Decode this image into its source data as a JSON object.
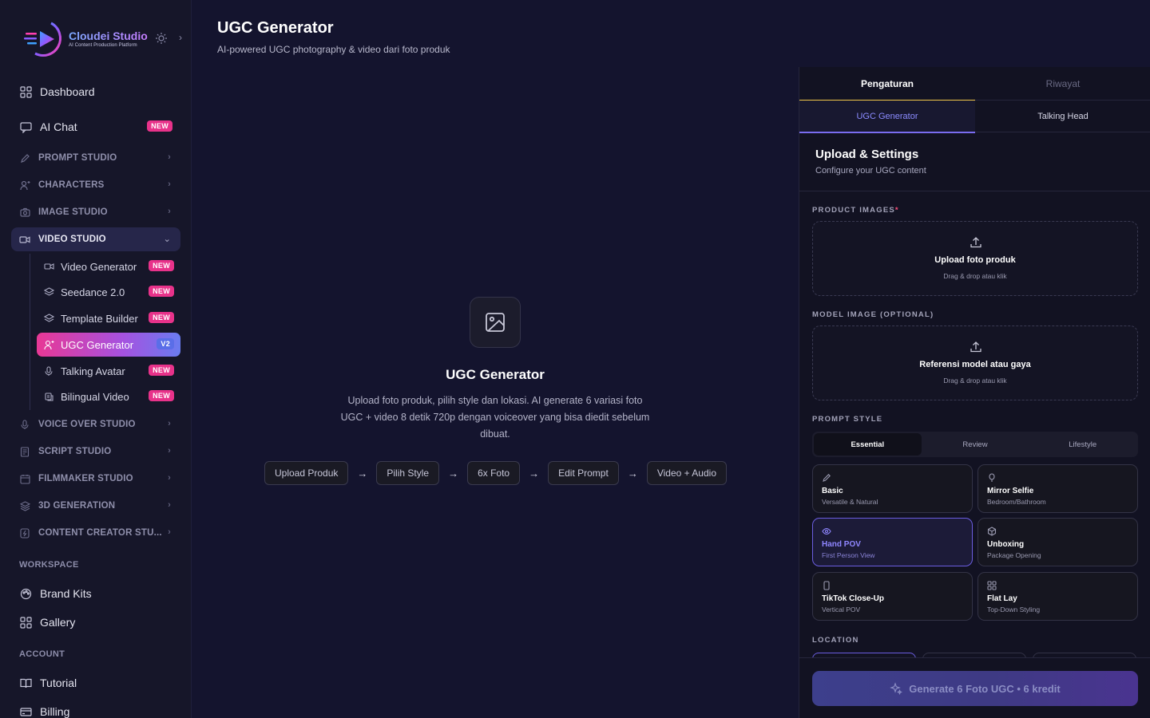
{
  "brand": {
    "name": "Cloudei Studio",
    "tagline": "AI Content Production Platform"
  },
  "sidebar": {
    "top_items": [
      {
        "label": "Dashboard",
        "icon": "grid-icon"
      },
      {
        "label": "AI Chat",
        "icon": "chat-icon",
        "badge": "NEW"
      }
    ],
    "sections": [
      {
        "label": "PROMPT STUDIO",
        "icon": "pen-icon"
      },
      {
        "label": "CHARACTERS",
        "icon": "user-sparkle-icon"
      },
      {
        "label": "IMAGE STUDIO",
        "icon": "camera-icon"
      },
      {
        "label": "VIDEO STUDIO",
        "icon": "video-icon",
        "open": true
      }
    ],
    "video_sub": [
      {
        "label": "Video Generator",
        "icon": "video-icon",
        "badge": "NEW"
      },
      {
        "label": "Seedance 2.0",
        "icon": "layers-icon",
        "badge": "NEW"
      },
      {
        "label": "Template Builder",
        "icon": "layers-icon",
        "badge": "NEW"
      },
      {
        "label": "UGC Generator",
        "icon": "user-sparkle-icon",
        "badge": "V2",
        "active": true
      },
      {
        "label": "Talking Avatar",
        "icon": "mic-icon",
        "badge": "NEW"
      },
      {
        "label": "Bilingual Video",
        "icon": "translate-icon",
        "badge": "NEW"
      }
    ],
    "sections_after": [
      {
        "label": "VOICE OVER STUDIO",
        "icon": "mic-icon"
      },
      {
        "label": "SCRIPT STUDIO",
        "icon": "document-icon"
      },
      {
        "label": "FILMMAKER STUDIO",
        "icon": "calendar-icon"
      },
      {
        "label": "3D GENERATION",
        "icon": "stack-icon"
      },
      {
        "label": "CONTENT CREATOR STU...",
        "icon": "bolt-icon"
      }
    ],
    "workspace_label": "WORKSPACE",
    "workspace_items": [
      {
        "label": "Brand Kits",
        "icon": "palette-icon"
      },
      {
        "label": "Gallery",
        "icon": "grid-icon"
      }
    ],
    "account_label": "ACCOUNT",
    "account_items": [
      {
        "label": "Tutorial",
        "icon": "book-icon"
      },
      {
        "label": "Billing",
        "icon": "card-icon"
      }
    ]
  },
  "header": {
    "title": "UGC Generator",
    "subtitle": "AI-powered UGC photography & video dari foto produk"
  },
  "empty_state": {
    "title": "UGC Generator",
    "description": "Upload foto produk, pilih style dan lokasi. AI generate 6 variasi foto UGC + video 8 detik 720p dengan voiceover yang bisa diedit sebelum dibuat.",
    "steps": [
      "Upload Produk",
      "Pilih Style",
      "6x Foto",
      "Edit Prompt",
      "Video + Audio"
    ],
    "arrow": "→"
  },
  "panel": {
    "tabs": [
      "Pengaturan",
      "Riwayat"
    ],
    "active_tab": 0,
    "subtabs": [
      "UGC Generator",
      "Talking Head"
    ],
    "active_subtab": 0,
    "title": "Upload & Settings",
    "subtitle": "Configure your UGC content",
    "product_label": "PRODUCT IMAGES",
    "required_mark": "*",
    "product_drop_title": "Upload foto produk",
    "product_drop_sub": "Drag & drop atau klik",
    "model_label": "MODEL IMAGE (OPTIONAL)",
    "model_drop_title": "Referensi model atau gaya",
    "model_drop_sub": "Drag & drop atau klik",
    "style_label": "PROMPT STYLE",
    "style_tabs": [
      "Essential",
      "Review",
      "Lifestyle"
    ],
    "active_style_tab": 0,
    "style_cards": [
      {
        "title": "Basic",
        "sub": "Versatile & Natural",
        "icon": "pencil-icon"
      },
      {
        "title": "Mirror Selfie",
        "sub": "Bedroom/Bathroom",
        "icon": "mirror-icon"
      },
      {
        "title": "Hand POV",
        "sub": "First Person View",
        "icon": "eye-icon",
        "active": true
      },
      {
        "title": "Unboxing",
        "sub": "Package Opening",
        "icon": "box-icon"
      },
      {
        "title": "TikTok Close-Up",
        "sub": "Vertical POV",
        "icon": "phone-icon"
      },
      {
        "title": "Flat Lay",
        "sub": "Top-Down Styling",
        "icon": "grid-icon"
      }
    ],
    "location_label": "LOCATION",
    "generate_label": "Generate 6 Foto UGC • 6 kredit"
  },
  "colors": {
    "background": "#14142e",
    "sidebar": "#161629",
    "accent_pink": "#e83895",
    "accent_purple": "#7a6cf0",
    "tab_underline": "#f0c64a",
    "badge_new": "#e8328a",
    "badge_v2": "#5a6ee8"
  }
}
